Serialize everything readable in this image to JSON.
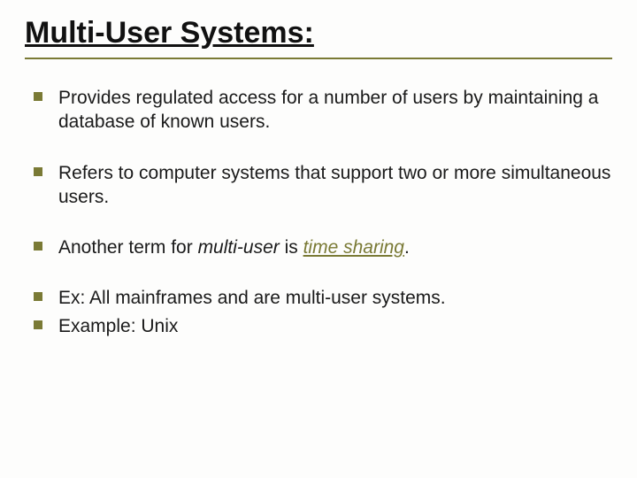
{
  "title": "Multi-User Systems:",
  "bullets": {
    "b0": "Provides regulated access for a number of users by maintaining a database of known users.",
    "b1": "Refers to computer systems that support two or more simultaneous users.",
    "b2_pre": "Another term for ",
    "b2_em": "multi-user",
    "b2_mid": " is ",
    "b2_link": "time sharing",
    "b2_post": ".",
    "b3": "Ex: All mainframes and  are multi-user systems.",
    "b4": "Example: Unix"
  }
}
